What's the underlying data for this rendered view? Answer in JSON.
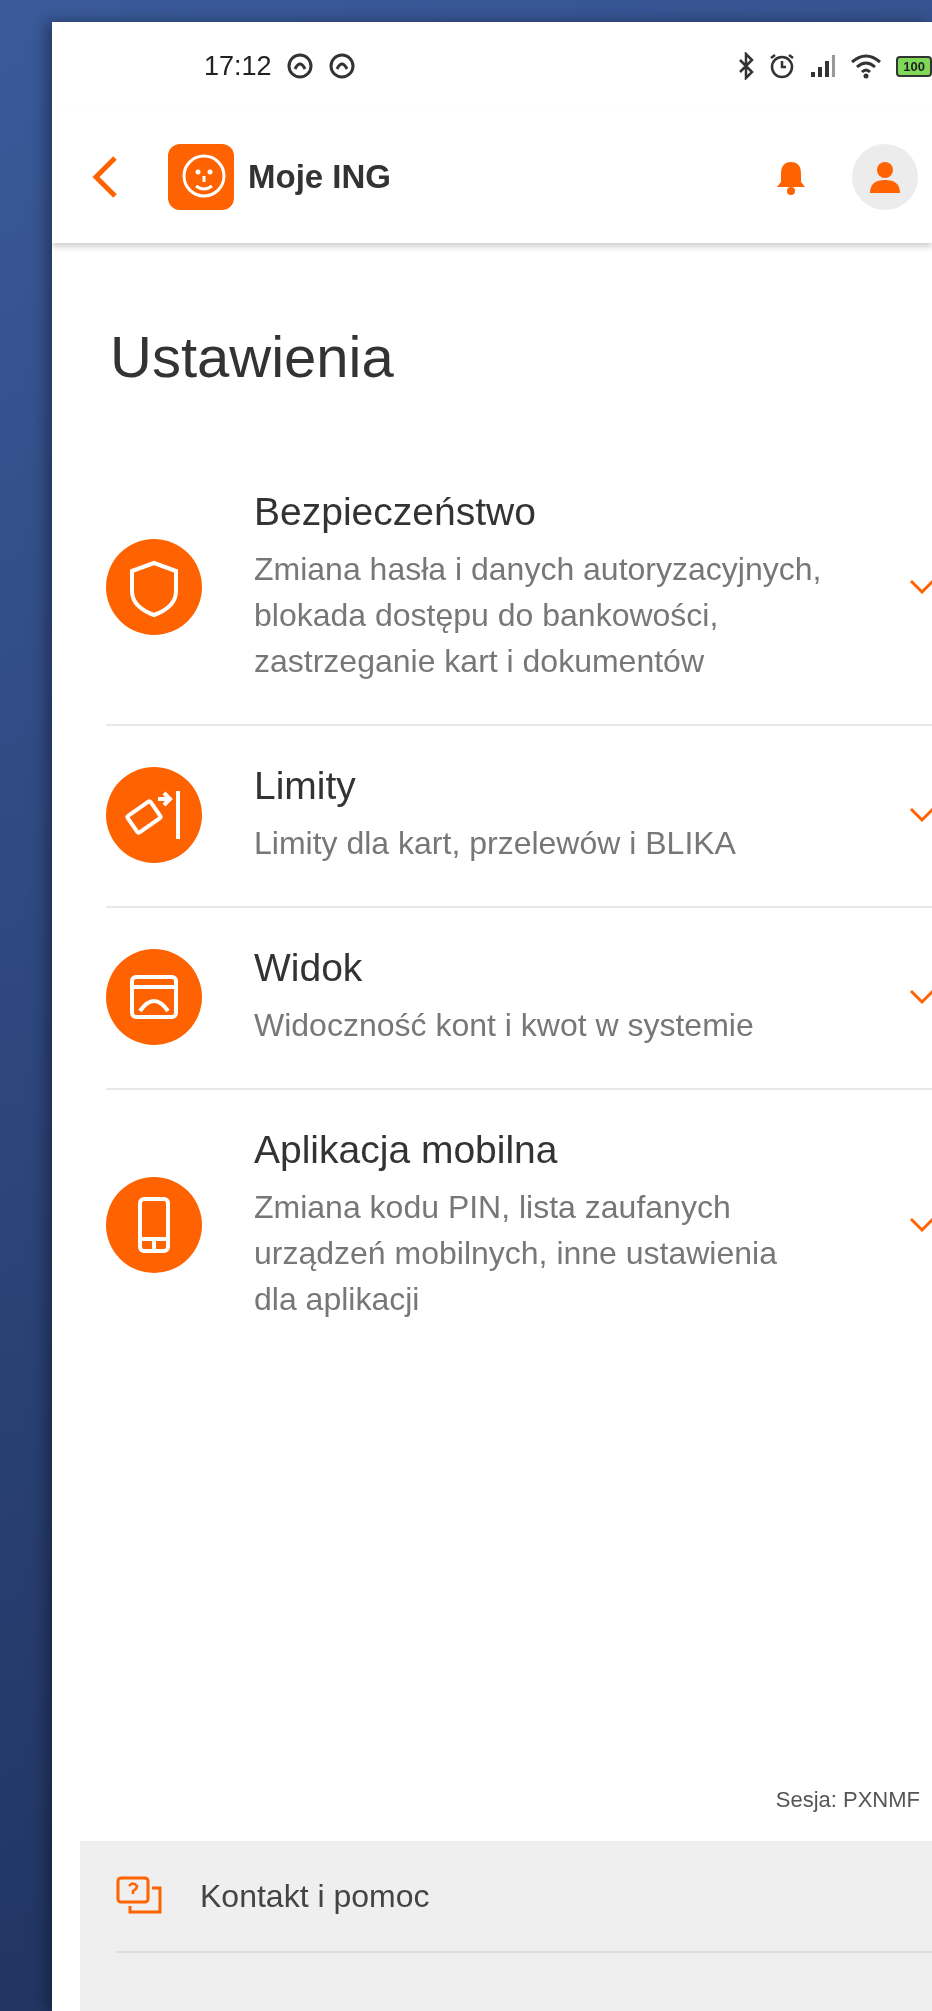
{
  "status_bar": {
    "time": "17:12",
    "battery": "100"
  },
  "header": {
    "title": "Moje ING"
  },
  "page_title": "Ustawienia",
  "sections": [
    {
      "title": "Bezpieczeństwo",
      "description": "Zmiana hasła i danych autoryzacyjnych, blokada dostępu do bankowości, zastrzeganie kart i dokumentów",
      "expanded": false
    },
    {
      "title": "Limity",
      "description": "Limity dla kart, przelewów i BLIKA",
      "expanded": false
    },
    {
      "title": "Widok",
      "description": "Widoczność kont i kwot w systemie",
      "expanded": false
    },
    {
      "title": "Aplikacja mobilna",
      "description": "Zmiana kodu PIN, lista zaufanych urządzeń mobilnych, inne ustawienia dla aplikacji",
      "expanded": false
    }
  ],
  "session": "Sesja: PXNMF",
  "footer": {
    "items": [
      {
        "label": "Kontakt i pomoc"
      }
    ]
  }
}
